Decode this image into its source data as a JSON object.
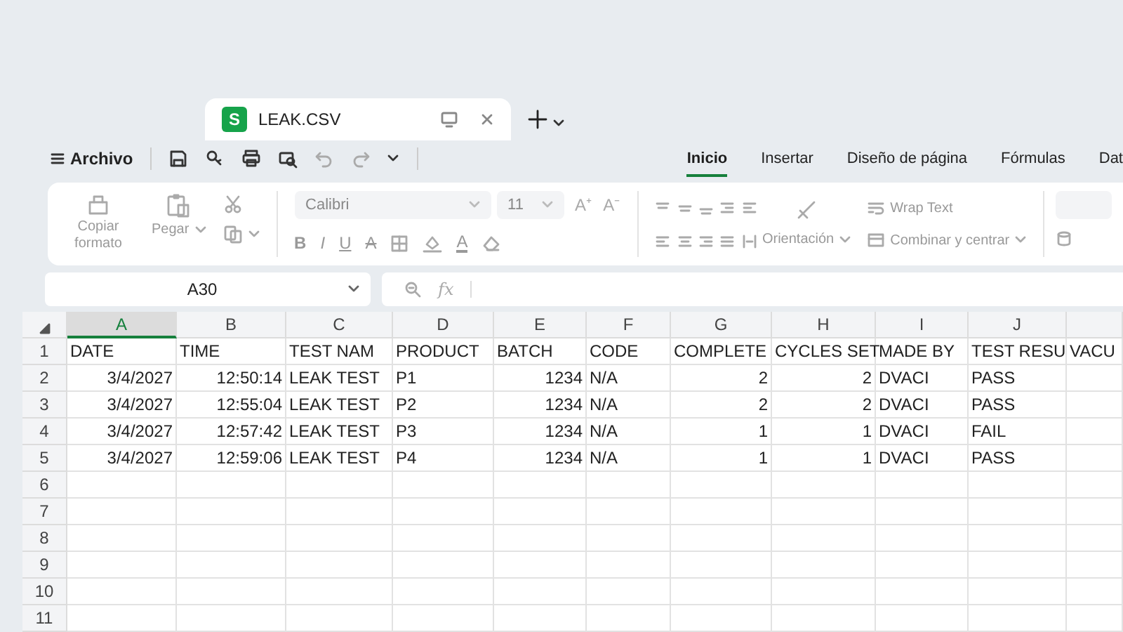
{
  "document_tab": {
    "app_letter": "S",
    "title": "LEAK.CSV",
    "selected": true
  },
  "menu": {
    "label": "Archivo"
  },
  "ribbon_tabs": [
    {
      "label": "Inicio",
      "selected": true
    },
    {
      "label": "Insertar",
      "selected": false
    },
    {
      "label": "Diseño de página",
      "selected": false
    },
    {
      "label": "Fórmulas",
      "selected": false
    },
    {
      "label": "Dat",
      "selected": false
    }
  ],
  "clipboard": {
    "format_painter": "Copiar formato",
    "paste": "Pegar"
  },
  "font": {
    "name": "Calibri",
    "size": "11",
    "grow": "A⁺",
    "shrink": "A⁻",
    "format_buttons": [
      {
        "kind": "bold",
        "label": "B"
      },
      {
        "kind": "italic",
        "label": "I"
      },
      {
        "kind": "underline",
        "label": "U"
      },
      {
        "kind": "strike",
        "label": "A"
      }
    ],
    "font_color": "A"
  },
  "alignment": {
    "orientation": "Orientación",
    "wrap_text": "Wrap Text",
    "merge": "Combinar y centrar"
  },
  "formula_bar": {
    "name_box": "A30",
    "function_label": "fx"
  },
  "grid": {
    "columns": [
      {
        "letter": "A",
        "selected": true
      },
      {
        "letter": "B",
        "selected": false
      },
      {
        "letter": "C",
        "selected": false
      },
      {
        "letter": "D",
        "selected": false
      },
      {
        "letter": "E",
        "selected": false
      },
      {
        "letter": "F",
        "selected": false
      },
      {
        "letter": "G",
        "selected": false
      },
      {
        "letter": "H",
        "selected": false
      },
      {
        "letter": "I",
        "selected": false
      },
      {
        "letter": "J",
        "selected": false
      },
      {
        "selected": false
      }
    ],
    "rows": [
      {
        "number": "1",
        "cells": [
          "DATE",
          "TIME",
          "TEST NAM",
          "PRODUCT",
          "BATCH",
          "CODE",
          "COMPLETE",
          "CYCLES SET",
          "MADE BY",
          "TEST RESU",
          "VACU"
        ]
      },
      {
        "number": "2",
        "cells": [
          "3/4/2027",
          "12:50:14",
          "LEAK TEST",
          "P1",
          "1234",
          "N/A",
          "2",
          "2",
          "DVACI",
          "PASS",
          null
        ]
      },
      {
        "number": "3",
        "cells": [
          "3/4/2027",
          "12:55:04",
          "LEAK TEST",
          "P2",
          "1234",
          "N/A",
          "2",
          "2",
          "DVACI",
          "PASS",
          null
        ]
      },
      {
        "number": "4",
        "cells": [
          "3/4/2027",
          "12:57:42",
          "LEAK TEST",
          "P3",
          "1234",
          "N/A",
          "1",
          "1",
          "DVACI",
          "FAIL",
          null
        ]
      },
      {
        "number": "5",
        "cells": [
          "3/4/2027",
          "12:59:06",
          "LEAK TEST",
          "P4",
          "1234",
          "N/A",
          "1",
          "1",
          "DVACI",
          "PASS",
          null
        ]
      },
      {
        "number": "6"
      },
      {
        "number": "7"
      },
      {
        "number": "8"
      },
      {
        "number": "9"
      },
      {
        "number": "10"
      },
      {
        "number": "11"
      }
    ]
  }
}
